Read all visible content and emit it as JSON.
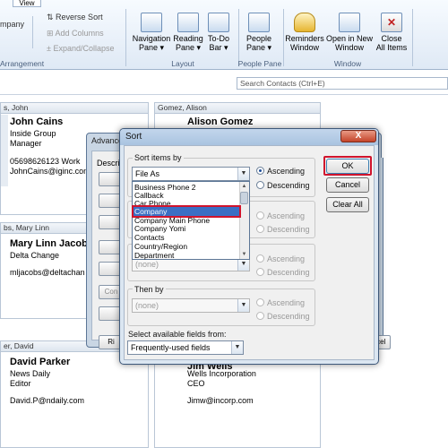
{
  "ribbon": {
    "tab_label": "View",
    "company_label": "mpany",
    "reverse_sort": "Reverse Sort",
    "add_columns": "Add Columns",
    "expand_collapse": "Expand/Collapse",
    "arrangement_group": "Arrangement",
    "navigation_pane": [
      "Navigation",
      "Pane"
    ],
    "reading_pane": [
      "Reading",
      "Pane"
    ],
    "todo_bar": [
      "To-Do",
      "Bar"
    ],
    "layout_group": "Layout",
    "people_pane": [
      "People",
      "Pane"
    ],
    "people_group": "People Pane",
    "reminders": [
      "Reminders",
      "Window"
    ],
    "open_new": [
      "Open in New",
      "Window"
    ],
    "close_all": [
      "Close",
      "All Items"
    ],
    "window_group": "Window"
  },
  "search": {
    "placeholder": "Search Contacts (Ctrl+E)"
  },
  "cards": [
    {
      "header": "s, John",
      "name": "John Cains",
      "lines": [
        "Inside Group",
        "Manager",
        "",
        "05698626123 Work",
        "JohnCains@iginc.com"
      ]
    },
    {
      "header": "Gomez, Alison",
      "name": "Alison Gomez",
      "lines": []
    },
    {
      "header": "bs, Mary Linn",
      "name": "Mary Linn Jacobs",
      "lines": [
        "Delta Change",
        "",
        "mljacobs@deltachan"
      ]
    },
    {
      "header": "er, David",
      "name": "David Parker",
      "lines": [
        "News Daily",
        "Editor",
        "",
        "David.P@ndaily.com"
      ]
    },
    {
      "header": "",
      "name": "Jim Wells",
      "lines": [
        "Wells Incorporation",
        "CEO",
        "",
        "Jimw@incorp.com"
      ]
    }
  ],
  "advanced_dialog": {
    "title": "Advance",
    "desc_label": "Descri",
    "btn_con": "Con",
    "btn_ri": "Ri",
    "btn_cel": "ncel"
  },
  "sort_dialog": {
    "title": "Sort",
    "close_label": "X",
    "sort_items_by": "Sort items by",
    "primary_value": "File As",
    "ascending": "Ascending",
    "descending": "Descending",
    "ok": "OK",
    "cancel": "Cancel",
    "clear_all": "Clear All",
    "then_by": "Then by",
    "third_value": "(none)",
    "fourth_value": "(none)",
    "select_fields_label": "Select available fields from:",
    "fields_source": "Frequently-used fields",
    "dropdown_items": [
      "Business Phone 2",
      "Callback",
      "Car Phone",
      "Company",
      "Company Main Phone",
      "Company Yomi",
      "Contacts",
      "Country/Region",
      "Department"
    ],
    "selected_item": "Company"
  },
  "colors": {
    "highlight": "#d0142d",
    "selection": "#3b6fc4"
  }
}
